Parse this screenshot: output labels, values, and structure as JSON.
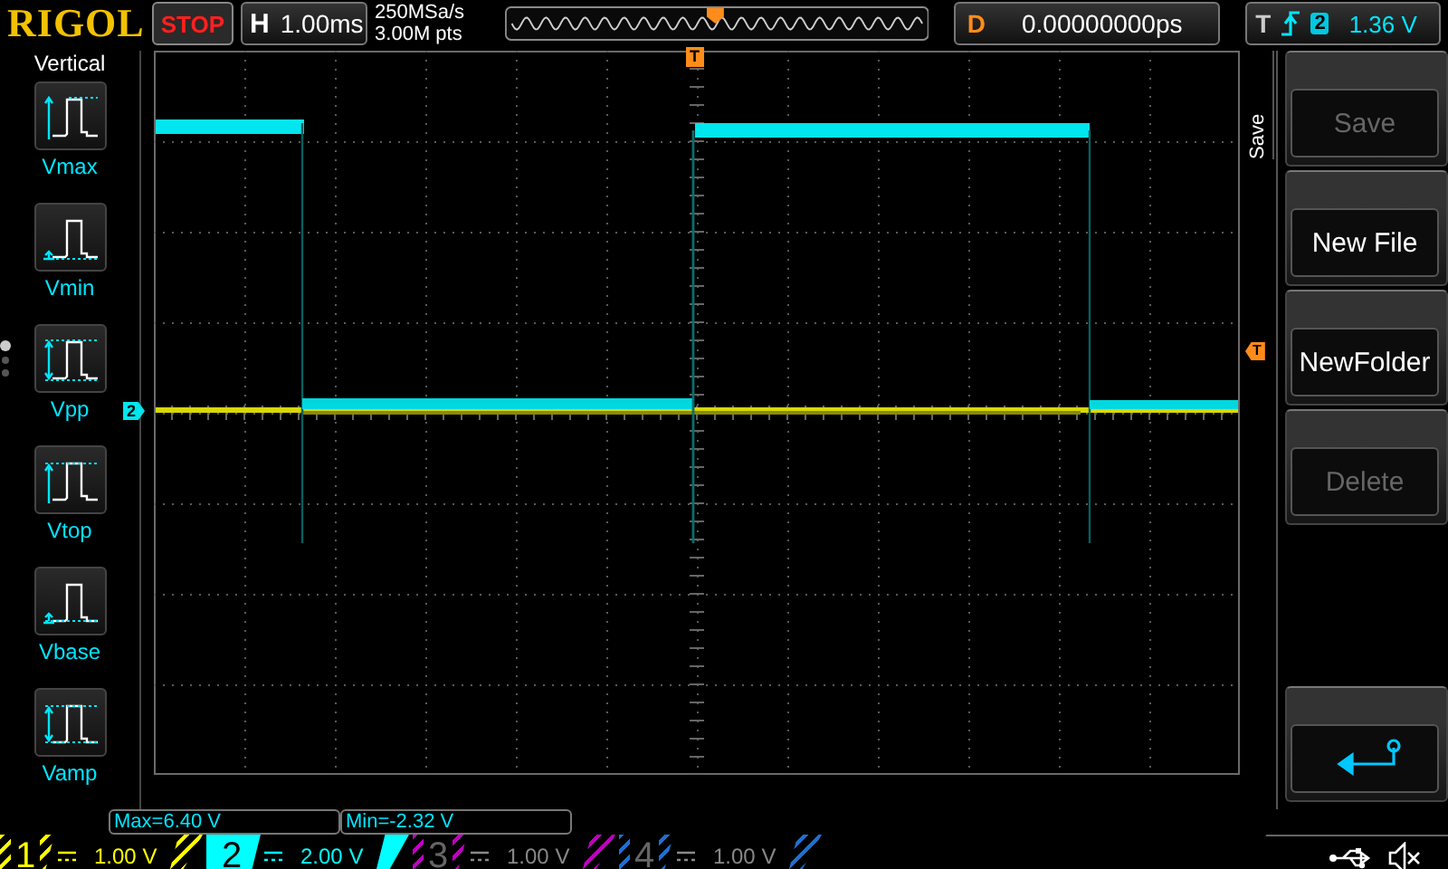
{
  "brand": "RIGOL",
  "run_state": {
    "label": "STOP",
    "kind": "stop"
  },
  "horizontal": {
    "label": "H",
    "value": "1.00ms"
  },
  "sample": {
    "rate": "250MSa/s",
    "depth": "3.00M pts"
  },
  "delay": {
    "label": "D",
    "value": "0.00000000ps"
  },
  "trigger": {
    "label": "T",
    "source": "2",
    "level": "1.36 V"
  },
  "left_menu": {
    "title": "Vertical",
    "items": [
      {
        "label": "Vmax",
        "kind": "vmax"
      },
      {
        "label": "Vmin",
        "kind": "vmin"
      },
      {
        "label": "Vpp",
        "kind": "vpp"
      },
      {
        "label": "Vtop",
        "kind": "vtop"
      },
      {
        "label": "Vbase",
        "kind": "vbase"
      },
      {
        "label": "Vamp",
        "kind": "vamp"
      }
    ],
    "pages": [
      {
        "selected": true
      },
      {
        "selected": false
      },
      {
        "selected": false
      }
    ]
  },
  "plot": {
    "trigger_position_marker": "T",
    "trigger_level_marker": "T",
    "channel_marker": "2"
  },
  "readouts": [
    "Max=6.40 V",
    "Min=-2.32 V"
  ],
  "right_menu": {
    "title": "Save",
    "buttons": [
      {
        "kind": "text",
        "label": "Save",
        "disabled": true
      },
      {
        "kind": "text",
        "label": "New File",
        "disabled": false
      },
      {
        "kind": "text",
        "label": "NewFolder",
        "disabled": false
      },
      {
        "kind": "text",
        "label": "Delete",
        "disabled": true
      },
      {
        "kind": "back"
      }
    ]
  },
  "channels": [
    {
      "number": "1",
      "scale": "1.00 V",
      "on": true,
      "selected": false,
      "color": "#ffff00"
    },
    {
      "number": "2",
      "scale": "2.00 V",
      "on": true,
      "selected": true,
      "color": "#00ffff"
    },
    {
      "number": "3",
      "scale": "1.00 V",
      "on": false,
      "selected": false,
      "color": "#c000c0"
    },
    {
      "number": "4",
      "scale": "1.00 V",
      "on": false,
      "selected": false,
      "color": "#1f6fd0"
    }
  ]
}
